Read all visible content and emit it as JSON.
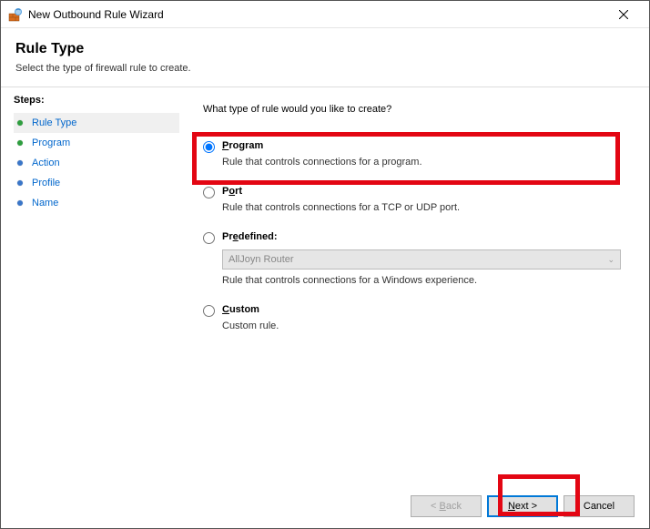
{
  "titlebar": {
    "text": "New Outbound Rule Wizard"
  },
  "header": {
    "title": "Rule Type",
    "subtitle": "Select the type of firewall rule to create."
  },
  "sidebar": {
    "title": "Steps:",
    "items": [
      {
        "label": "Rule Type"
      },
      {
        "label": "Program"
      },
      {
        "label": "Action"
      },
      {
        "label": "Profile"
      },
      {
        "label": "Name"
      }
    ]
  },
  "main": {
    "question": "What type of rule would you like to create?",
    "options": {
      "program": {
        "label_prefix": "P",
        "label_rest": "rogram",
        "desc": "Rule that controls connections for a program."
      },
      "port": {
        "label_prefix": "",
        "label_underline": "o",
        "label_before": "P",
        "label_after": "rt",
        "desc": "Rule that controls connections for a TCP or UDP port."
      },
      "predefined": {
        "label_underline": "e",
        "label_before": "Pr",
        "label_after": "defined:",
        "desc": "Rule that controls connections for a Windows experience.",
        "select_value": "AllJoyn Router"
      },
      "custom": {
        "label_underline": "C",
        "label_rest": "ustom",
        "desc": "Custom rule."
      }
    }
  },
  "footer": {
    "back_prefix": "< ",
    "back_underline": "B",
    "back_rest": "ack",
    "next_underline": "N",
    "next_rest": "ext >",
    "cancel": "Cancel"
  }
}
